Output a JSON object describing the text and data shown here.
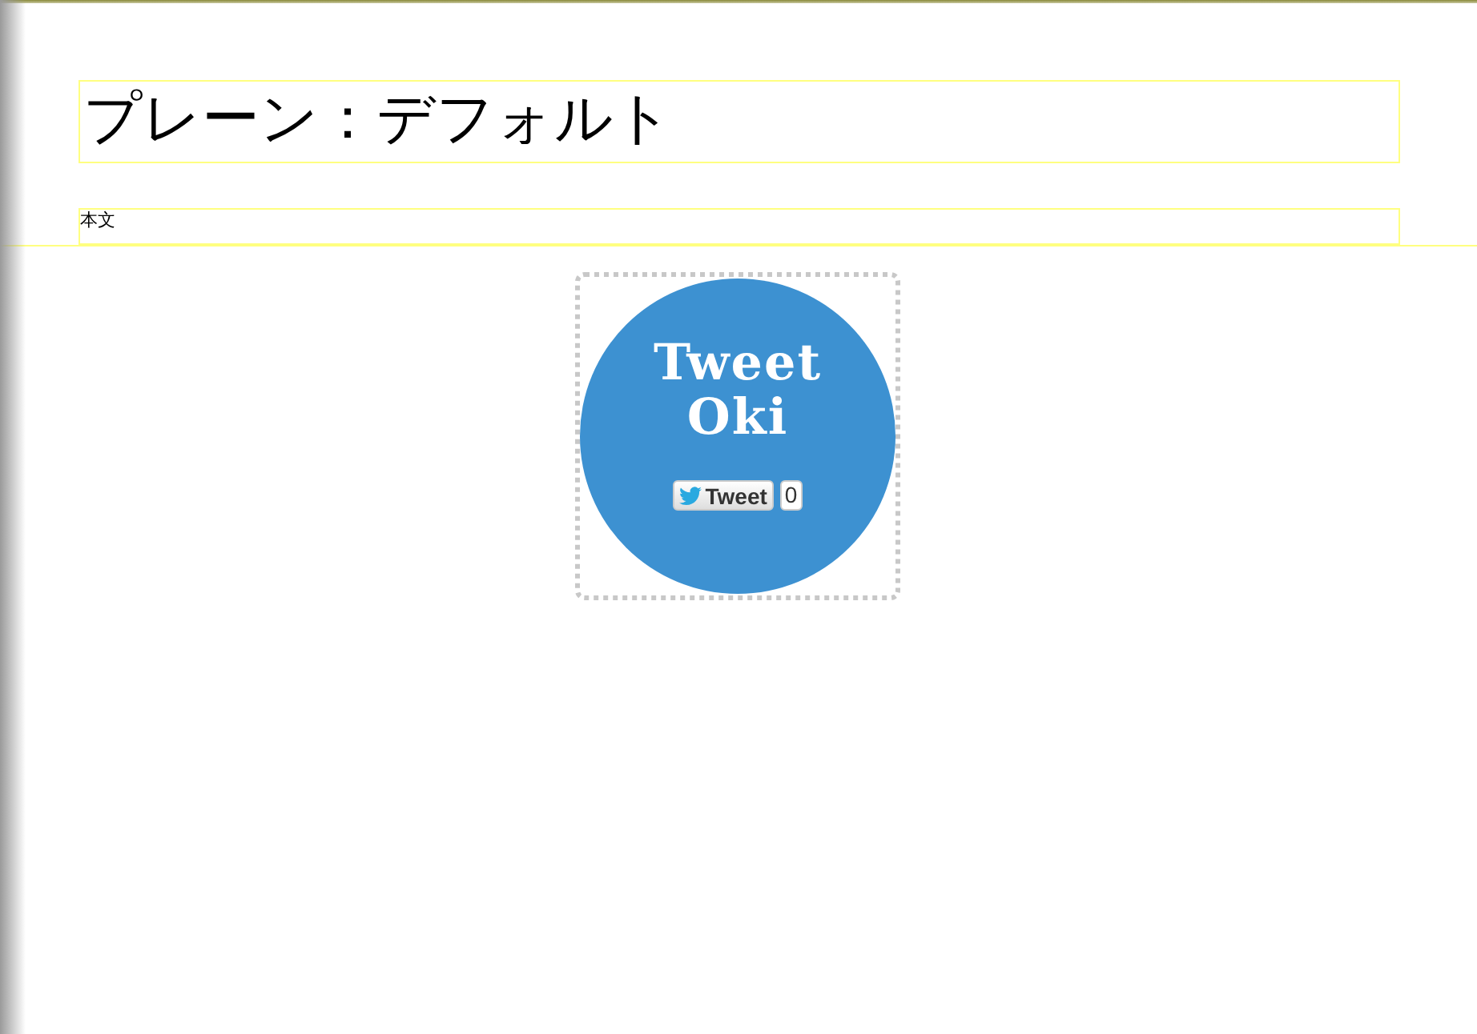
{
  "header": {
    "title": "プレーン：デフォルト",
    "body": "本文"
  },
  "widget": {
    "title_lines": [
      "Tweet",
      "Oki"
    ],
    "tweet_button": {
      "label": "Tweet",
      "count": "0"
    }
  }
}
